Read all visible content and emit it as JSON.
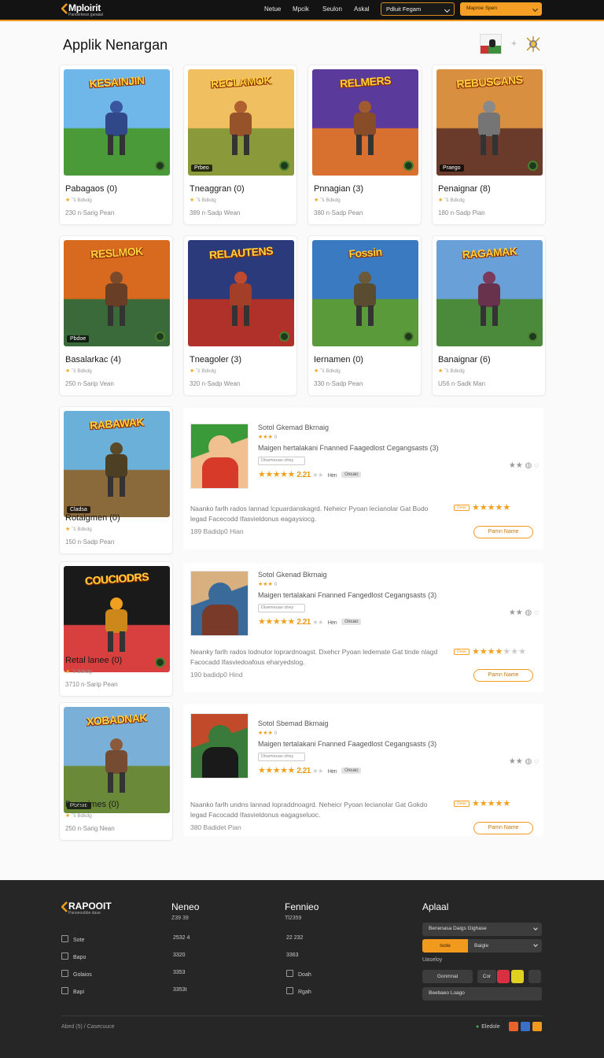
{
  "header": {
    "logo_name": "Mploirit",
    "logo_tagline": "Pancerkeso gunaial",
    "nav": [
      "Netue",
      "Mpcik",
      "Seulon",
      "Askal"
    ],
    "search_value": "Pdluit Fegam",
    "cta_value": "Maproe Spen",
    "accent_color": "#f29a1e"
  },
  "page": {
    "title": "Applik Nenargan"
  },
  "grid": [
    {
      "thumb_title": "KESAINJIN",
      "badge": "",
      "name": "Pabagaos (0)",
      "rating_text": "ˇš Bdkdg",
      "meta": "230  n·Sarig Pean",
      "colors": [
        "#6fb7e8",
        "#4a9a3a",
        "#3a55a0"
      ]
    },
    {
      "thumb_title": "RECLAMOK",
      "badge": "Prbeo",
      "name": "Tneaggran (0)",
      "rating_text": "ˇš Bdkdg",
      "meta": "389  n·Sadp Wean",
      "colors": [
        "#f0c060",
        "#8a9a3a",
        "#b06030"
      ]
    },
    {
      "thumb_title": "RELMERS",
      "badge": "",
      "name": "Pnnagian (3)",
      "rating_text": "ˇš Bdkdg",
      "meta": "380  n·Sadp Pean",
      "colors": [
        "#5a3a9a",
        "#d87030",
        "#a05a30"
      ]
    },
    {
      "thumb_title": "REBUSCANS",
      "badge": "Praego",
      "name": "Penaignar (8)",
      "rating_text": "ˇš Bdkdg",
      "meta": "180  n·Sadp Pian",
      "colors": [
        "#d89040",
        "#6a3a2a",
        "#8a8a8a"
      ]
    },
    {
      "thumb_title": "RESLMOK",
      "badge": "Pbdoe",
      "name": "Basalarkac (4)",
      "rating_text": "ˇš Bdkdg",
      "meta": "250  n·Sarip Vean",
      "colors": [
        "#d86a20",
        "#3a6a3a",
        "#7a4a2a"
      ]
    },
    {
      "thumb_title": "RELAUTENS",
      "badge": "",
      "name": "Tneagoler (3)",
      "rating_text": "ˇš Bdkdg",
      "meta": "320  n·Sadp Wean",
      "colors": [
        "#2a3a7a",
        "#b0302a",
        "#c04a30"
      ]
    },
    {
      "thumb_title": "Fossin",
      "badge": "",
      "name": "Iernamen (0)",
      "rating_text": "ˇš Bdkdg",
      "meta": "330  n·Sadp Pean",
      "colors": [
        "#3a7ac0",
        "#5a9a3a",
        "#6a5a3a"
      ]
    },
    {
      "thumb_title": "RAGAMAK",
      "badge": "",
      "name": "Banaignar (6)",
      "rating_text": "ˇš Bdkdg",
      "meta": "U56  n·Sadk Man",
      "colors": [
        "#6aa0d8",
        "#4a8a3a",
        "#7a3a5a"
      ]
    }
  ],
  "list": [
    {
      "thumb_title": "RABAWAK",
      "badge": "Cladsa",
      "name": "Rotalgmen (0)",
      "rating_text": "ˇš Bdkdg",
      "meta": "150  n·Sadp Pean",
      "colors": [
        "#6ab0d8",
        "#8a6a3a",
        "#5a4a2a"
      ],
      "panel": {
        "title": "Sotol Gkemad Bkrnaig",
        "small_count": "0",
        "desc": "Maigen hertalakani Fnanned Faagedlost Cegangsasts   (3)",
        "chip": "Dlsemeuao  ohey",
        "score": "2.21",
        "lbl": "Hen",
        "tag": "Greuao",
        "long": "Naanko farlh rados  lannad lcpuardanskagrd.  Neheicr  Pyoan  lecianolar Gat Budo legad Facecodd Ifasvieldonus eagaysiocg.",
        "mini": "Deae",
        "count": "189  Badidp0 Hian",
        "button": "Pamn Name",
        "icon_colors": [
          "#d83a2a",
          "#3a9a3a",
          "#f0c090"
        ]
      }
    },
    {
      "thumb_title": "COUCIODRS",
      "badge": "",
      "name": "Retal lanee (0)",
      "rating_text": "ˇš Bdkdg",
      "meta": "3710  n·Sarip Pean",
      "colors": [
        "#1a1a1a",
        "#d84040",
        "#f0a020"
      ],
      "panel": {
        "title": "Sotol Gkenad Bkrnaig",
        "small_count": "0",
        "desc": "Maigen tertalakani Fnanned Fangedlost Cegangsasts   (3)",
        "chip": "Dlsemeuao  ohey",
        "score": "2.21",
        "lbl": "Hen",
        "tag": "Greuao",
        "long": "Neanky farlh rados  lodnutor loprardnoagst.  Dxehcr  Pyoan  ledemate Gat tinde nlagd Facocadd Ifasviedoafous eharyedslog.",
        "mini": "Deae",
        "count": "190  badidp0 Hind",
        "button": "Pamn Name",
        "icon_colors": [
          "#7a3a2a",
          "#d8b080",
          "#3a6a9a"
        ]
      }
    },
    {
      "thumb_title": "XOBADNAK",
      "badge": "Rbdsro",
      "name": "Poumimes (0)",
      "rating_text": "ˇš Bdkdg",
      "meta": "250  n·Sarig Nean",
      "colors": [
        "#7ab0d8",
        "#6a8a3a",
        "#8a5a3a"
      ],
      "panel": {
        "title": "Sotol Sbemad Bkrnaig",
        "small_count": "0",
        "desc": "Maigen tertalakani Fnanned Faagedlost Cegangsasts   (3)",
        "chip": "Dlsemeuao  ohey",
        "score": "2.21",
        "lbl": "Hen",
        "tag": "Greuao",
        "long": "Naanko farlh undns lannad lopraddnoagrd.  Neheicr  Pyoan  lecianolar Gat  Gokdo legad Facocadd Ifasvieldonus eagagseluoc.",
        "mini": "Deae",
        "count": "380  Badidet Pian",
        "button": "Pamn Name",
        "icon_colors": [
          "#1a1a1a",
          "#c04a2a",
          "#3a7a3a"
        ]
      }
    }
  ],
  "footer": {
    "logo_name": "RAPOOIT",
    "logo_tagline": "Panoeoubbe daue",
    "col1_title": "Neneo",
    "col1_sub": "Z39 39",
    "col2_title": "Fennieo",
    "col2_sub": "Tl2359",
    "col3_title": "Aplaal",
    "rows_left": [
      "Sote",
      "Bapo",
      "Golaios",
      "Bapi"
    ],
    "rows_mid": [
      "2532 4",
      "3320",
      "3353",
      "3353t"
    ],
    "rows_right": [
      "22 232",
      "3363",
      "Doah",
      "Rgah"
    ],
    "select1": "Benenasa Daigs    Gighase",
    "orange_btn": "Isole",
    "select2": "Baigle",
    "label": "Uaseloy",
    "btn_a": "Gonmnal",
    "btn_b": "Cor",
    "wide": "Beebaeo Loago",
    "copyright": "Abed (5) / Casecuuce",
    "status": "Eledole"
  }
}
